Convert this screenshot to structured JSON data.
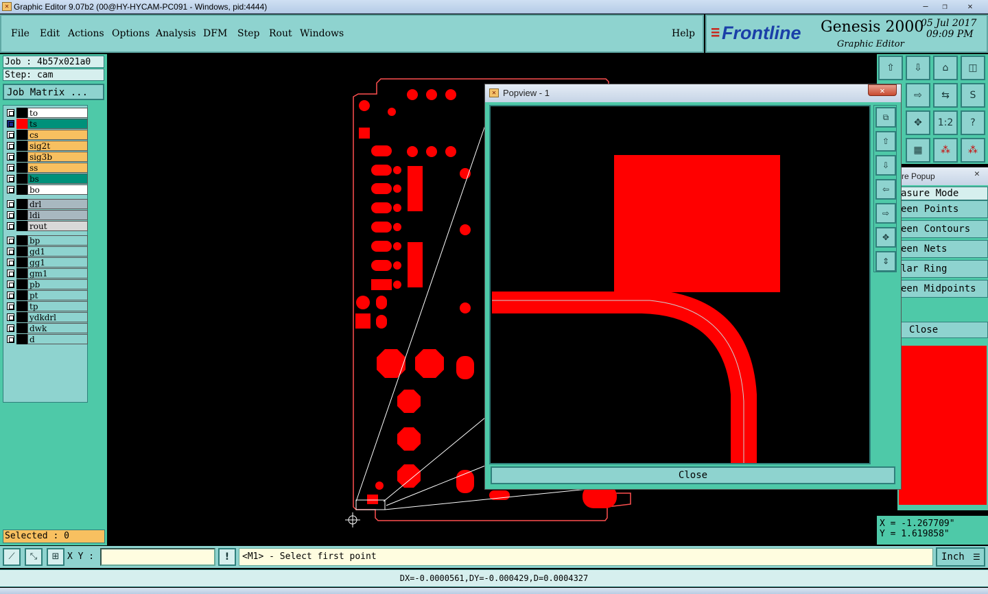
{
  "window": {
    "title": "Graphic Editor 9.07b2 (00@HY-HYCAM-PC091 - Windows, pid:4444)",
    "min_icon": "minimize-icon",
    "max_icon": "maximize-icon",
    "close_icon": "close-icon"
  },
  "menu": {
    "items": [
      "File",
      "Edit",
      "Actions",
      "Options",
      "Analysis",
      "DFM",
      "Step",
      "Rout",
      "Windows"
    ],
    "help": "Help"
  },
  "brand": {
    "logo": "Frontline",
    "product": "Genesis 2000",
    "subtitle": "Graphic Editor",
    "date": "05 Jul 2017",
    "time": "09:09 PM"
  },
  "job": {
    "job_label": "Job : 4b57x021a0",
    "step_label": "Step: cam",
    "matrix_button": "Job Matrix ..."
  },
  "layers": {
    "group1": [
      {
        "name": "to",
        "color": "#ffffff"
      },
      {
        "name": "ts",
        "color": "#00917a"
      },
      {
        "name": "cs",
        "color": "#f8c060"
      },
      {
        "name": "sig2t",
        "color": "#f8c060"
      },
      {
        "name": "sig3b",
        "color": "#f8c060"
      },
      {
        "name": "ss",
        "color": "#f8c060"
      },
      {
        "name": "bs",
        "color": "#00917a"
      },
      {
        "name": "bo",
        "color": "#ffffff"
      }
    ],
    "group2": [
      {
        "name": "drl",
        "color": "#a8b8c0"
      },
      {
        "name": "ldi",
        "color": "#a8b8c0"
      },
      {
        "name": "rout",
        "color": "#d8d8d8"
      }
    ],
    "group3": [
      {
        "name": "bp",
        "color": "#8ed3cf"
      },
      {
        "name": "gd1",
        "color": "#8ed3cf"
      },
      {
        "name": "gg1",
        "color": "#8ed3cf"
      },
      {
        "name": "gm1",
        "color": "#8ed3cf"
      },
      {
        "name": "pb",
        "color": "#8ed3cf"
      },
      {
        "name": "pt",
        "color": "#8ed3cf"
      },
      {
        "name": "tp",
        "color": "#8ed3cf"
      },
      {
        "name": "ydkdrl",
        "color": "#8ed3cf"
      },
      {
        "name": "dwk",
        "color": "#8ed3cf"
      },
      {
        "name": "d",
        "color": "#8ed3cf"
      }
    ]
  },
  "selected": "Selected : 0",
  "popview": {
    "title": "Popview - 1",
    "close_button": "Close"
  },
  "measure": {
    "title": "re Popup",
    "mode_header": "asure Mode",
    "options": [
      "een Points",
      "een Contours",
      "een Nets",
      "lar Ring",
      "een Midpoints"
    ],
    "close_button": "Close"
  },
  "coords": {
    "x": "X = -1.267709\"",
    "y": "Y = 1.619858\""
  },
  "status": {
    "xy_label": "X Y :",
    "xy_value": "",
    "prompt": "<M1> - Select first point",
    "units": "Inch",
    "dx_line": "DX=-0.0000561,DY=-0.000429,D=0.0004327"
  },
  "right_toolbar": {
    "zoom_ratio": "1:2",
    "help": "?"
  }
}
